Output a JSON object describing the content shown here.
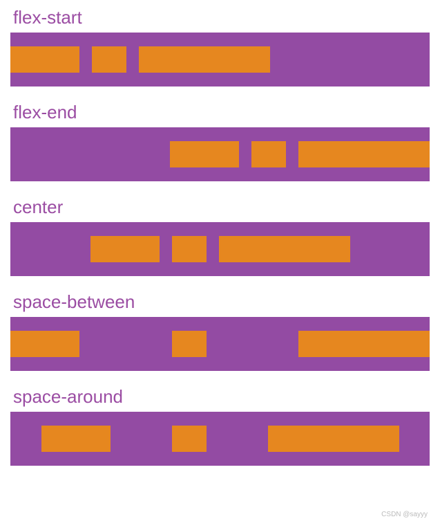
{
  "sections": [
    {
      "label": "flex-start",
      "justify": "flex-start"
    },
    {
      "label": "flex-end",
      "justify": "flex-end"
    },
    {
      "label": "center",
      "justify": "center"
    },
    {
      "label": "space-between",
      "justify": "space-between"
    },
    {
      "label": "space-around",
      "justify": "space-around"
    }
  ],
  "boxes": [
    {
      "size": "w1"
    },
    {
      "size": "w2"
    },
    {
      "size": "w3"
    }
  ],
  "colors": {
    "container": "#934ba3",
    "box": "#e6871f",
    "label": "#9b4da3"
  },
  "watermark": "CSDN @sayyy"
}
